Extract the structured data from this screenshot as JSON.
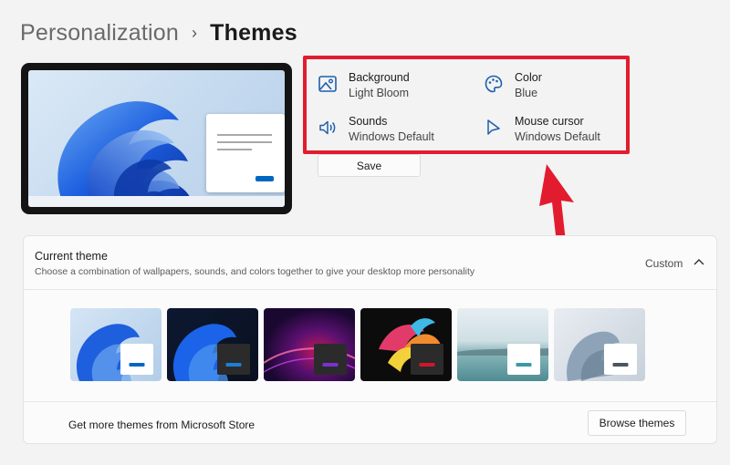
{
  "breadcrumb": {
    "parent": "Personalization",
    "separator": "›",
    "current": "Themes"
  },
  "settings": {
    "background": {
      "label": "Background",
      "value": "Light Bloom",
      "icon": "image-icon"
    },
    "color": {
      "label": "Color",
      "value": "Blue",
      "icon": "palette-icon"
    },
    "sounds": {
      "label": "Sounds",
      "value": "Windows Default",
      "icon": "speaker-icon"
    },
    "mouse_cursor": {
      "label": "Mouse cursor",
      "value": "Windows Default",
      "icon": "cursor-icon"
    }
  },
  "save_label": "Save",
  "current_theme": {
    "title": "Current theme",
    "description": "Choose a combination of wallpapers, sounds, and colors together to give your desktop more personality",
    "value": "Custom"
  },
  "themes": [
    {
      "style": "light-bloom",
      "accent": "#0067c0",
      "mini_bg": "#ffffff"
    },
    {
      "style": "dark-bloom",
      "accent": "#1a7fd6",
      "mini_bg": "#2b2b2b"
    },
    {
      "style": "glow",
      "accent": "#7b2fd0",
      "mini_bg": "#2b2b2b"
    },
    {
      "style": "captured-motion",
      "accent": "#d0162c",
      "mini_bg": "#2b2b2b"
    },
    {
      "style": "sunrise",
      "accent": "#3a9aa8",
      "mini_bg": "#ffffff"
    },
    {
      "style": "flow",
      "accent": "#4a5560",
      "mini_bg": "#ffffff"
    }
  ],
  "store": {
    "text": "Get more themes from Microsoft Store",
    "button_label": "Browse themes"
  },
  "colors": {
    "highlight": "#e21c2e",
    "accent": "#0067c0"
  }
}
